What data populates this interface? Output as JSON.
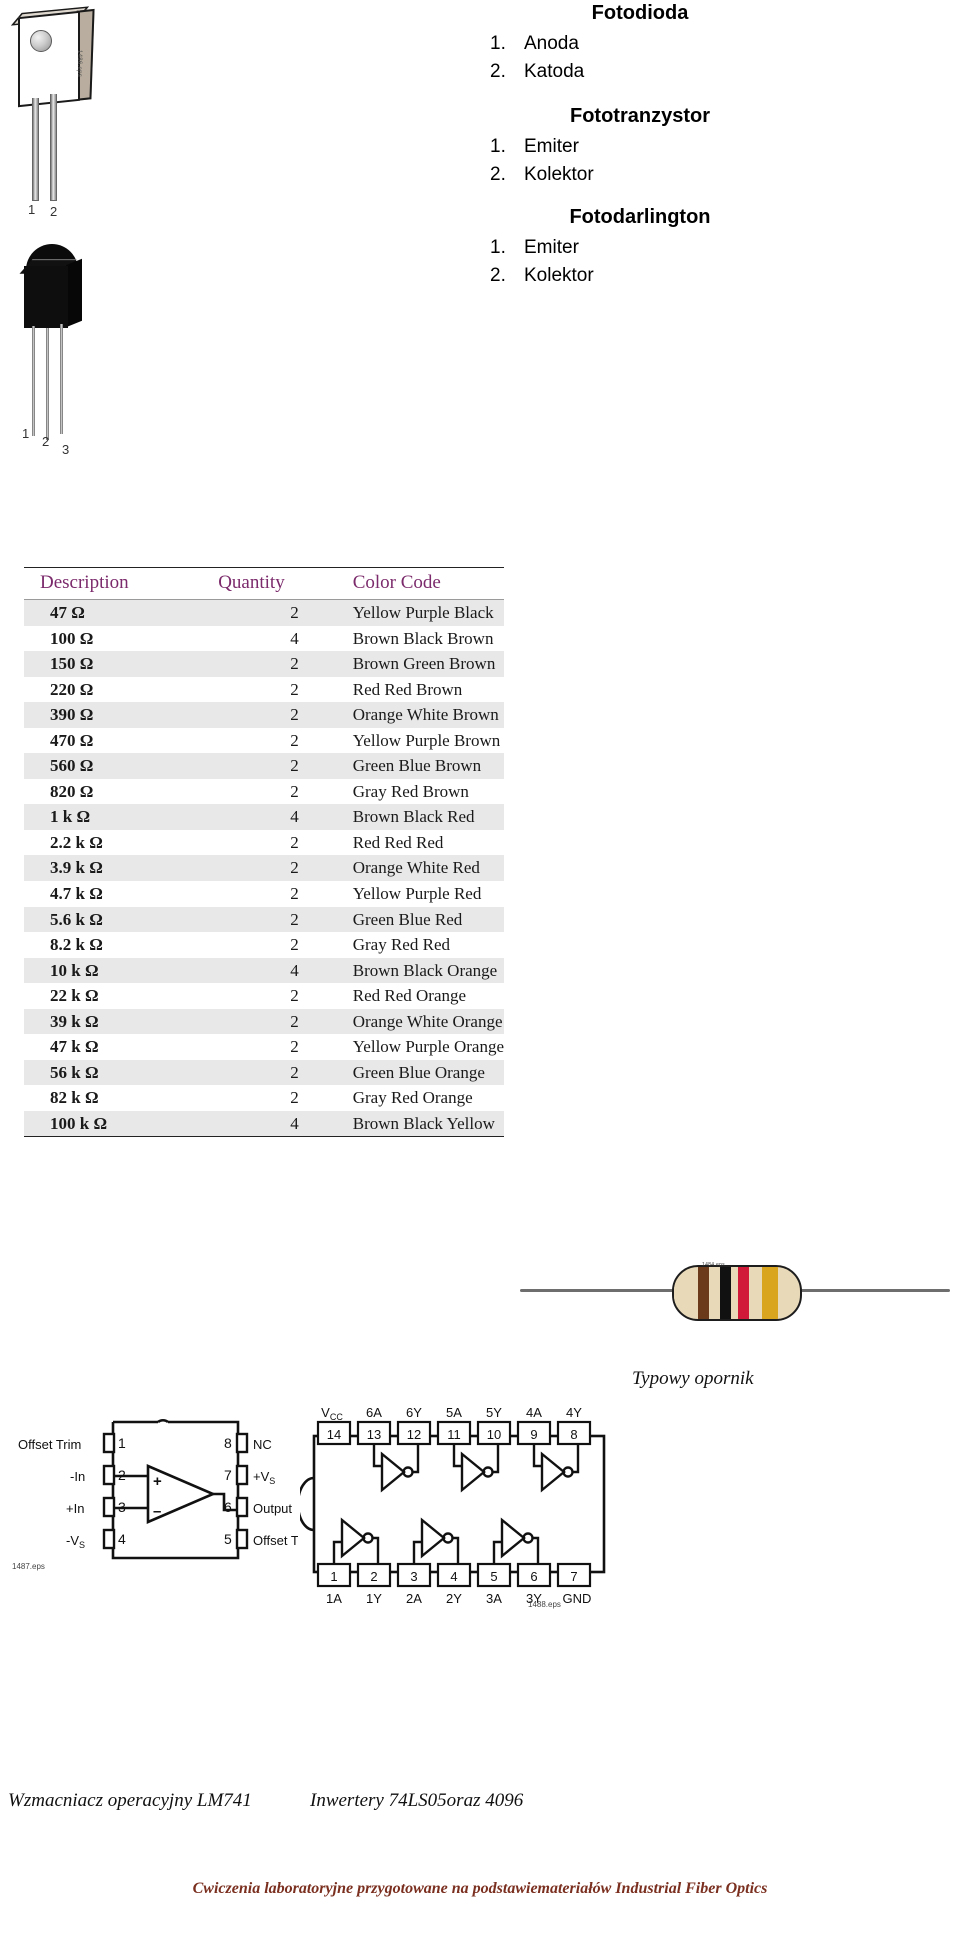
{
  "components": [
    {
      "title": "Fotodioda",
      "pins": [
        {
          "num": "1.",
          "label": "Anoda"
        },
        {
          "num": "2.",
          "label": "Katoda"
        }
      ]
    },
    {
      "title": "Fototranzystor",
      "pins": [
        {
          "num": "1.",
          "label": "Emiter"
        },
        {
          "num": "2.",
          "label": "Kolektor"
        }
      ]
    },
    {
      "title": "Fotodarlington",
      "pins": [
        {
          "num": "1.",
          "label": "Emiter"
        },
        {
          "num": "2.",
          "label": "Kolektor"
        }
      ]
    }
  ],
  "photodiode_figure": {
    "pin_labels": [
      "1",
      "2"
    ],
    "eps_code": "1486.eps"
  },
  "phototransistor_figure": {
    "pin_labels": [
      "1",
      "2",
      "3"
    ]
  },
  "resistor_table": {
    "headers": [
      "Description",
      "Quantity",
      "Color Code"
    ],
    "header_color": "#7b2a6b",
    "rows": [
      {
        "description": "47 Ω",
        "quantity": "2",
        "color_code": "Yellow Purple Black"
      },
      {
        "description": "100 Ω",
        "quantity": "4",
        "color_code": "Brown Black Brown"
      },
      {
        "description": "150 Ω",
        "quantity": "2",
        "color_code": "Brown Green Brown"
      },
      {
        "description": "220 Ω",
        "quantity": "2",
        "color_code": "Red Red Brown"
      },
      {
        "description": "390 Ω",
        "quantity": "2",
        "color_code": "Orange White Brown"
      },
      {
        "description": "470 Ω",
        "quantity": "2",
        "color_code": "Yellow Purple Brown"
      },
      {
        "description": "560 Ω",
        "quantity": "2",
        "color_code": "Green Blue Brown"
      },
      {
        "description": "820 Ω",
        "quantity": "2",
        "color_code": "Gray Red Brown"
      },
      {
        "description": "1 k Ω",
        "quantity": "4",
        "color_code": "Brown Black Red"
      },
      {
        "description": "2.2 k Ω",
        "quantity": "2",
        "color_code": "Red Red Red"
      },
      {
        "description": "3.9 k Ω",
        "quantity": "2",
        "color_code": "Orange White Red"
      },
      {
        "description": "4.7 k Ω",
        "quantity": "2",
        "color_code": "Yellow Purple Red"
      },
      {
        "description": "5.6 k Ω",
        "quantity": "2",
        "color_code": "Green Blue Red"
      },
      {
        "description": "8.2 k Ω",
        "quantity": "2",
        "color_code": "Gray Red Red"
      },
      {
        "description": "10 k Ω",
        "quantity": "4",
        "color_code": "Brown Black Orange"
      },
      {
        "description": "22 k Ω",
        "quantity": "2",
        "color_code": "Red Red Orange"
      },
      {
        "description": "39 k Ω",
        "quantity": "2",
        "color_code": "Orange White Orange"
      },
      {
        "description": "47 k Ω",
        "quantity": "2",
        "color_code": "Yellow Purple Orange"
      },
      {
        "description": "56 k Ω",
        "quantity": "2",
        "color_code": "Green Blue Orange"
      },
      {
        "description": "82 k Ω",
        "quantity": "2",
        "color_code": "Gray Red Orange"
      },
      {
        "description": "100 k Ω",
        "quantity": "4",
        "color_code": "Brown Black Yellow"
      }
    ]
  },
  "resistor_photo": {
    "caption": "Typowy opornik",
    "band_colors": [
      "#6b3a1a",
      "#111111",
      "#d11a3a",
      "#d9a41e"
    ],
    "tiny_text": "1484.eps"
  },
  "lm741": {
    "caption": "Wzmacniacz operacyjny LM741",
    "eps_tag": "1487.eps",
    "left_pins": [
      {
        "num": "1",
        "label": "Offset Trim"
      },
      {
        "num": "2",
        "label": "-In"
      },
      {
        "num": "3",
        "label": "+In"
      },
      {
        "num": "4",
        "label": "-Vₛ"
      }
    ],
    "right_pins": [
      {
        "num": "8",
        "label": "NC"
      },
      {
        "num": "7",
        "label": "+Vₛ"
      },
      {
        "num": "6",
        "label": "Output"
      },
      {
        "num": "5",
        "label": "Offset Trim"
      }
    ],
    "amp_inputs": [
      "+",
      "–"
    ]
  },
  "hex_inverter": {
    "caption": "Inwertery 74LS05oraz  4096",
    "eps_tag": "1488.eps",
    "top_pins": [
      {
        "num": "14",
        "label": "Vcc"
      },
      {
        "num": "13",
        "label": "6A"
      },
      {
        "num": "12",
        "label": "6Y"
      },
      {
        "num": "11",
        "label": "5A"
      },
      {
        "num": "10",
        "label": "5Y"
      },
      {
        "num": "9",
        "label": "4A"
      },
      {
        "num": "8",
        "label": "4Y"
      }
    ],
    "bottom_pins": [
      {
        "num": "1",
        "label": "1A"
      },
      {
        "num": "2",
        "label": "1Y"
      },
      {
        "num": "3",
        "label": "2A"
      },
      {
        "num": "4",
        "label": "2Y"
      },
      {
        "num": "5",
        "label": "3A"
      },
      {
        "num": "6",
        "label": "3Y"
      },
      {
        "num": "7",
        "label": "GND"
      }
    ]
  },
  "footer": {
    "text": "Cwiczenia laboratoryjne  przygotowane na podstawiemateriałów Industrial Fiber Optics",
    "color": "#7a2f1f"
  }
}
